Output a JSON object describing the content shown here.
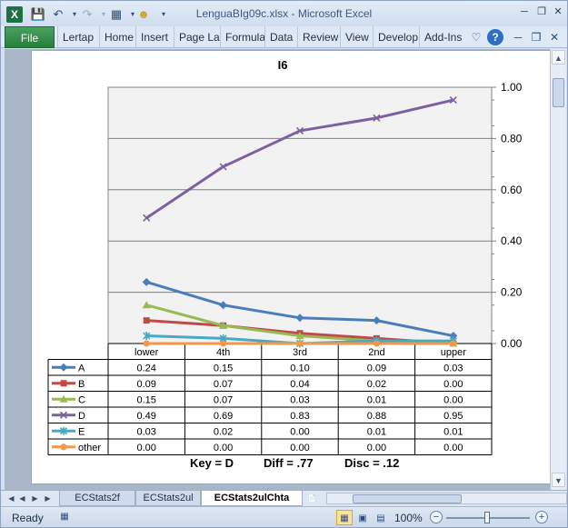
{
  "window": {
    "title": "LenguaBIg09c.xlsx - Microsoft Excel",
    "app_icon_label": "X"
  },
  "qat": {
    "save_icon": "save-icon",
    "undo_icon": "undo-icon",
    "redo_icon": "redo-icon",
    "customize_icon": "dropdown-icon"
  },
  "ribbon": {
    "file_label": "File",
    "tabs": [
      "Lertap",
      "Home",
      "Insert",
      "Page La",
      "Formula",
      "Data",
      "Review",
      "View",
      "Develop",
      "Add-Ins"
    ]
  },
  "chart_data": {
    "type": "line",
    "title": "I6",
    "categories": [
      "lower",
      "4th",
      "3rd",
      "2nd",
      "upper"
    ],
    "ylim": [
      0,
      1
    ],
    "y_ticks": [
      "0.00",
      "0.20",
      "0.40",
      "0.60",
      "0.80",
      "1.00"
    ],
    "y_axis_position": "right",
    "grid": true,
    "series": [
      {
        "name": "A",
        "values": [
          0.24,
          0.15,
          0.1,
          0.09,
          0.03
        ],
        "labels": [
          "0.24",
          "0.15",
          "0.10",
          "0.09",
          "0.03"
        ],
        "color": "#4a7ebb",
        "marker": "diamond"
      },
      {
        "name": "B",
        "values": [
          0.09,
          0.07,
          0.04,
          0.02,
          0.0
        ],
        "labels": [
          "0.09",
          "0.07",
          "0.04",
          "0.02",
          "0.00"
        ],
        "color": "#be4b48",
        "marker": "square"
      },
      {
        "name": "C",
        "values": [
          0.15,
          0.07,
          0.03,
          0.01,
          0.0
        ],
        "labels": [
          "0.15",
          "0.07",
          "0.03",
          "0.01",
          "0.00"
        ],
        "color": "#98b954",
        "marker": "triangle"
      },
      {
        "name": "D",
        "values": [
          0.49,
          0.69,
          0.83,
          0.88,
          0.95
        ],
        "labels": [
          "0.49",
          "0.69",
          "0.83",
          "0.88",
          "0.95"
        ],
        "color": "#7d60a0",
        "marker": "x"
      },
      {
        "name": "E",
        "values": [
          0.03,
          0.02,
          0.0,
          0.01,
          0.01
        ],
        "labels": [
          "0.03",
          "0.02",
          "0.00",
          "0.01",
          "0.01"
        ],
        "color": "#46aac5",
        "marker": "star"
      },
      {
        "name": "other",
        "values": [
          0.0,
          0.0,
          0.0,
          0.0,
          0.0
        ],
        "labels": [
          "0.00",
          "0.00",
          "0.00",
          "0.00",
          "0.00"
        ],
        "color": "#f79646",
        "marker": "circle"
      }
    ],
    "footer": {
      "key": "Key = D",
      "diff": "Diff = .77",
      "disc": "Disc = .12"
    }
  },
  "sheet_tabs": [
    "ECStats2f",
    "ECStats2ul",
    "ECStats2ulChta"
  ],
  "active_sheet": "ECStats2ulChta",
  "status": {
    "ready": "Ready",
    "zoom": "100%"
  }
}
